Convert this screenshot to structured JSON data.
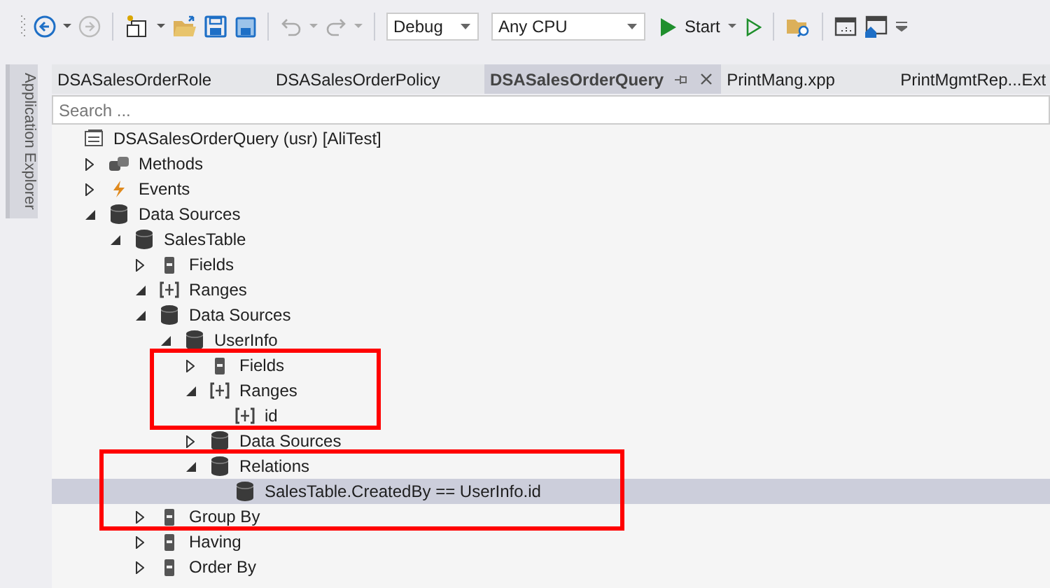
{
  "toolbar": {
    "configuration": "Debug",
    "platform": "Any CPU",
    "start_label": "Start"
  },
  "side_tab": {
    "label": "Application Explorer"
  },
  "tabs": [
    {
      "label": "DSASalesOrderRole",
      "selected": false
    },
    {
      "label": "DSASalesOrderPolicy",
      "selected": false
    },
    {
      "label": "DSASalesOrderQuery",
      "selected": true
    },
    {
      "label": "PrintMang.xpp",
      "selected": false
    },
    {
      "label": "PrintMgmtRep...Ext",
      "selected": false
    }
  ],
  "search": {
    "placeholder": "Search ..."
  },
  "tree": [
    {
      "label": "DSASalesOrderQuery (usr) [AliTest]",
      "kind": "query",
      "selected": false,
      "highlighted": false,
      "children": [
        {
          "label": "Methods",
          "kind": "methods",
          "expanded": false,
          "selected": false,
          "highlighted": false
        },
        {
          "label": "Events",
          "kind": "events",
          "expanded": false,
          "selected": false,
          "highlighted": false
        },
        {
          "label": "Data Sources",
          "kind": "datasource",
          "expanded": true,
          "selected": false,
          "highlighted": false,
          "children": [
            {
              "label": "SalesTable",
              "kind": "datasource",
              "expanded": true,
              "selected": false,
              "highlighted": false,
              "children": [
                {
                  "label": "Fields",
                  "kind": "fields",
                  "expanded": false,
                  "selected": false,
                  "highlighted": false
                },
                {
                  "label": "Ranges",
                  "kind": "ranges",
                  "expanded": true,
                  "selected": false,
                  "highlighted": false
                },
                {
                  "label": "Data Sources",
                  "kind": "datasource",
                  "expanded": true,
                  "selected": false,
                  "highlighted": false,
                  "children": [
                    {
                      "label": "UserInfo",
                      "kind": "datasource",
                      "expanded": true,
                      "selected": false,
                      "highlighted": false,
                      "children": [
                        {
                          "label": "Fields",
                          "kind": "fields",
                          "expanded": false,
                          "selected": false,
                          "highlighted": true
                        },
                        {
                          "label": "Ranges",
                          "kind": "ranges",
                          "expanded": true,
                          "selected": false,
                          "highlighted": true,
                          "children": [
                            {
                              "label": "id",
                              "kind": "ranges",
                              "selected": false,
                              "highlighted": true
                            }
                          ]
                        },
                        {
                          "label": "Data Sources",
                          "kind": "datasource",
                          "expanded": false,
                          "selected": false,
                          "highlighted": false
                        },
                        {
                          "label": "Relations",
                          "kind": "datasource",
                          "expanded": true,
                          "selected": false,
                          "highlighted": true,
                          "children": [
                            {
                              "label": "SalesTable.CreatedBy == UserInfo.id",
                              "kind": "datasource",
                              "selected": true,
                              "highlighted": true
                            }
                          ]
                        }
                      ]
                    }
                  ]
                },
                {
                  "label": "Group By",
                  "kind": "fields",
                  "expanded": false,
                  "selected": false,
                  "highlighted": true
                },
                {
                  "label": "Having",
                  "kind": "fields",
                  "expanded": false,
                  "selected": false,
                  "highlighted": false
                },
                {
                  "label": "Order By",
                  "kind": "fields",
                  "expanded": false,
                  "selected": false,
                  "highlighted": false
                }
              ]
            }
          ]
        }
      ]
    }
  ]
}
